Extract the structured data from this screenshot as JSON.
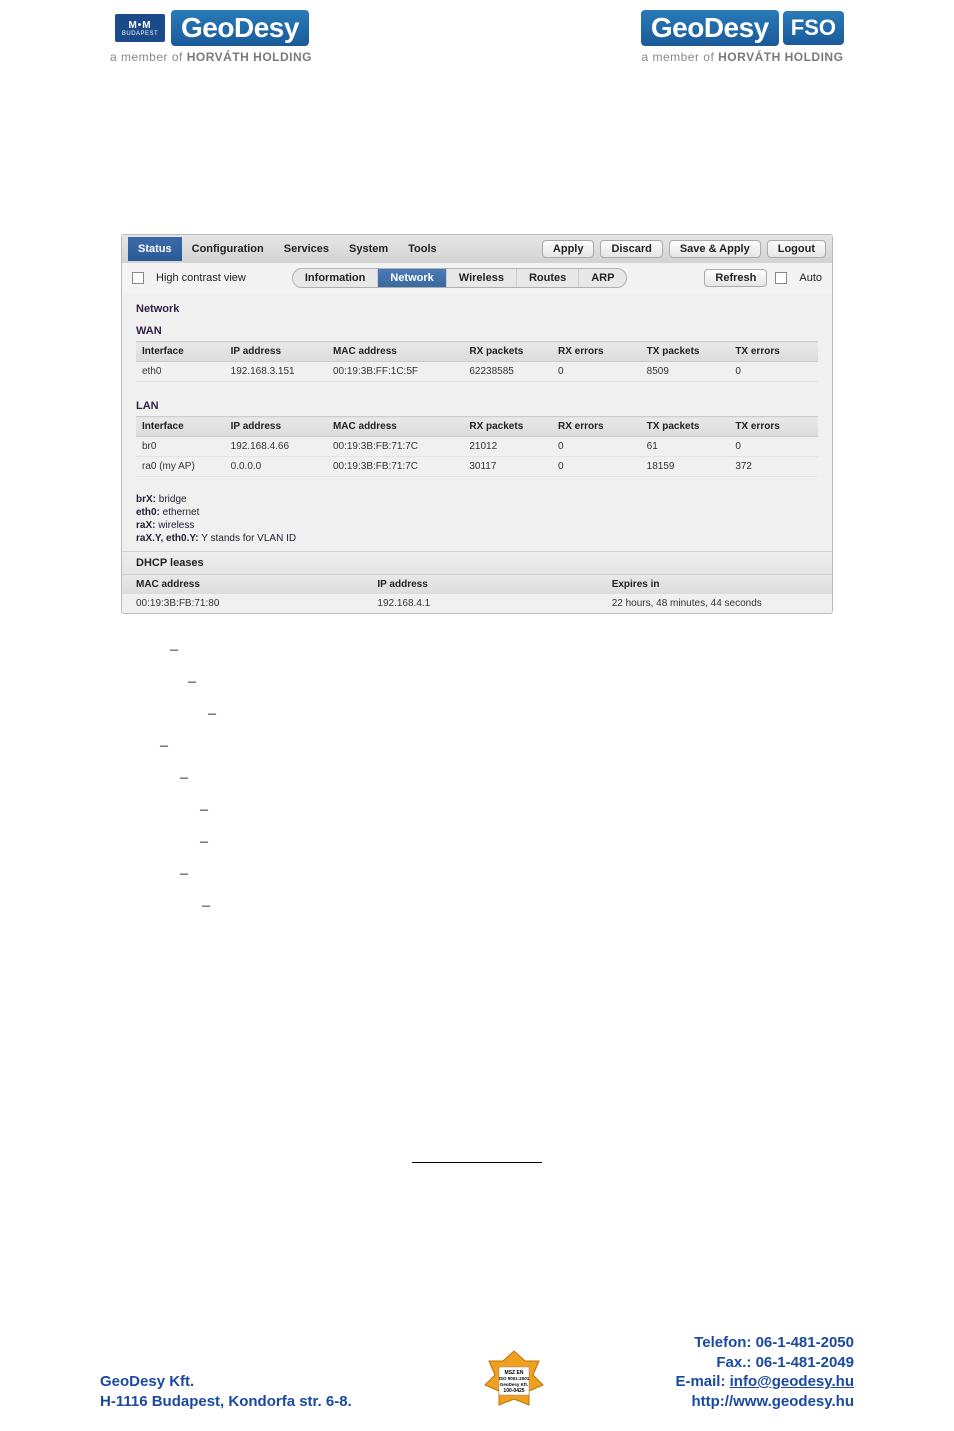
{
  "header": {
    "left_badge_top": "M•M",
    "left_badge_bottom": "BUDAPEST",
    "brand": "GeoDesy",
    "member_line_prefix": "a member of ",
    "member_line_brand": "HORVÁTH HOLDING",
    "fso": "FSO"
  },
  "app": {
    "topnav": [
      "Status",
      "Configuration",
      "Services",
      "System",
      "Tools"
    ],
    "topnav_active": "Status",
    "buttons": {
      "apply": "Apply",
      "discard": "Discard",
      "saveapply": "Save & Apply",
      "logout": "Logout"
    },
    "subbar": {
      "high_contrast": "High contrast view",
      "sub_tabs": [
        "Information",
        "Network",
        "Wireless",
        "Routes",
        "ARP"
      ],
      "sub_active": "Network",
      "refresh": "Refresh",
      "auto": "Auto"
    },
    "sections": {
      "network_title": "Network",
      "wan_title": "WAN",
      "lan_title": "LAN"
    },
    "cols": [
      "Interface",
      "IP address",
      "MAC address",
      "RX packets",
      "RX errors",
      "TX packets",
      "TX errors"
    ],
    "wan_rows": [
      {
        "iface": "eth0",
        "ip": "192.168.3.151",
        "mac": "00:19:3B:FF:1C:5F",
        "rxp": "62238585",
        "rxe": "0",
        "txp": "8509",
        "txe": "0"
      }
    ],
    "lan_rows": [
      {
        "iface": "br0",
        "ip": "192.168.4.66",
        "mac": "00:19:3B:FB:71:7C",
        "rxp": "21012",
        "rxe": "0",
        "txp": "61",
        "txe": "0"
      },
      {
        "iface": "ra0 (my AP)",
        "ip": "0.0.0.0",
        "mac": "00:19:3B:FB:71:7C",
        "rxp": "30117",
        "rxe": "0",
        "txp": "18159",
        "txe": "372"
      }
    ],
    "legend": {
      "l1a": "brX:",
      "l1b": " bridge",
      "l2a": "eth0:",
      "l2b": " ethernet",
      "l3a": "raX:",
      "l3b": " wireless",
      "l4a": "raX.Y, eth0.Y:",
      "l4b": " Y stands for VLAN ID"
    },
    "dhcp": {
      "title": "DHCP leases",
      "cols": [
        "MAC address",
        "IP address",
        "Expires in"
      ],
      "rows": [
        {
          "mac": "00:19:3B:FB:71:80",
          "ip": "192.168.4.1",
          "exp": "22 hours, 48 minutes, 44 seconds"
        }
      ]
    }
  },
  "dashes": [
    "–",
    "–",
    "–",
    "–",
    "–",
    "–",
    "–",
    "–",
    "–"
  ],
  "dash_indents": [
    20,
    38,
    58,
    10,
    30,
    50,
    50,
    30,
    52
  ],
  "footer": {
    "company": "GeoDesy Kft.",
    "address": "H-1116 Budapest, Kondorfa str. 6-8.",
    "tel": "Telefon: 06-1-481-2050",
    "fax": "Fax.: 06-1-481-2049",
    "email_label": "E-mail: ",
    "email": "info@geodesy.hu",
    "web": "http://www.geodesy.hu",
    "cert_l1": "MSZ EN",
    "cert_l2": "ISO 9001:2001",
    "cert_l3": "GeoDesy Kft.",
    "cert_l4": "100-0425"
  }
}
